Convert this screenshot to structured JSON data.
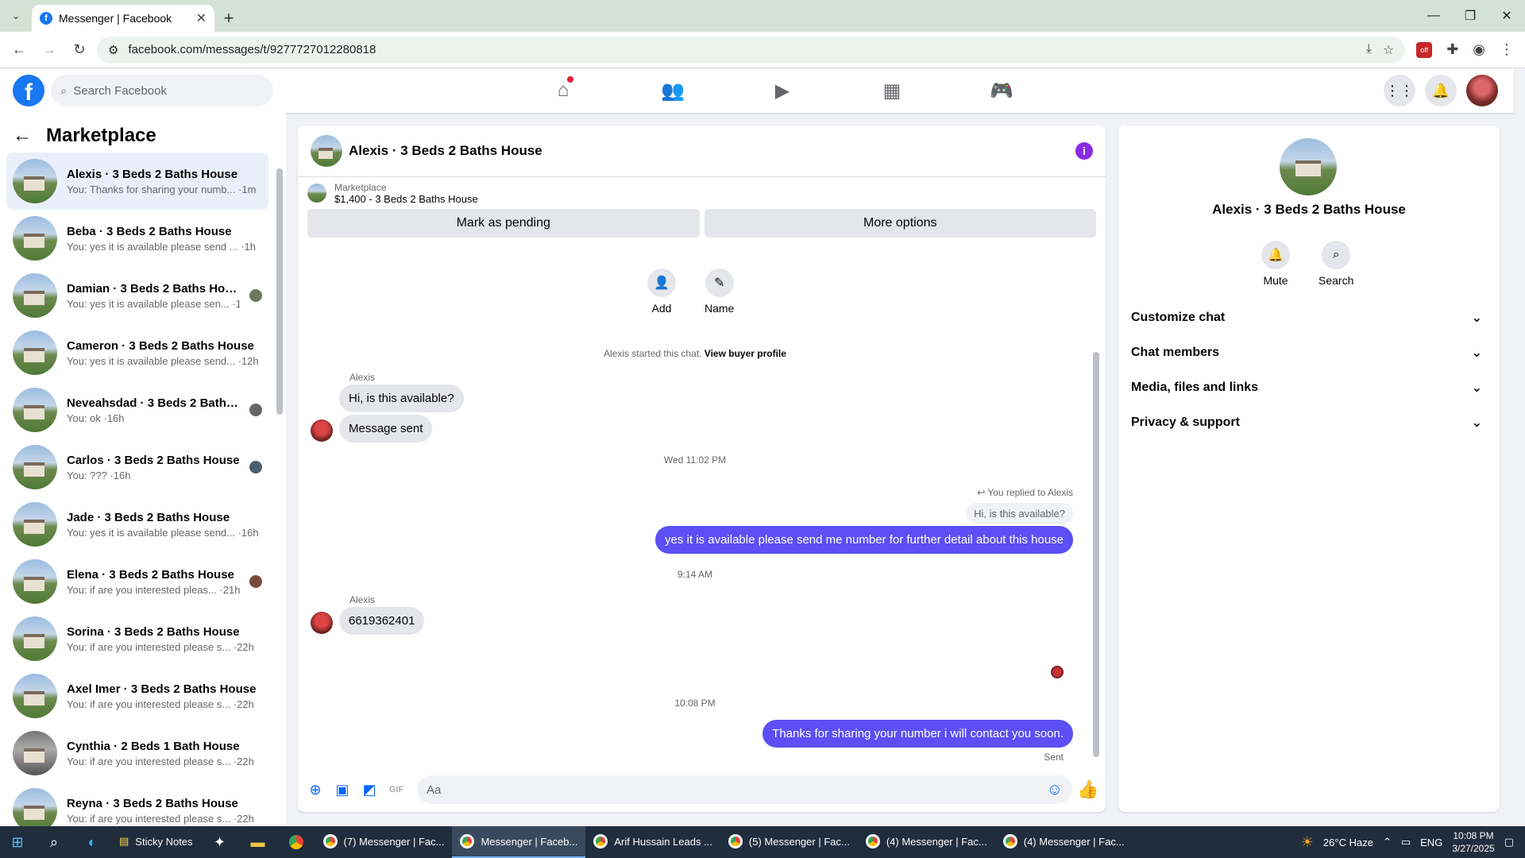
{
  "browser": {
    "tab_title": "Messenger | Facebook",
    "url": "facebook.com/messages/t/9277727012280818"
  },
  "header": {
    "search_placeholder": "Search Facebook",
    "logo": "f"
  },
  "left": {
    "title": "Marketplace",
    "conversations": [
      {
        "name": "Alexis · 3 Beds 2 Baths House",
        "preview": "You: Thanks for sharing your numb... ·1m"
      },
      {
        "name": "Beba · 3 Beds 2 Baths House",
        "preview": "You: yes it is available please send ... ·1h"
      },
      {
        "name": "Damian · 3 Beds 2 Baths House",
        "preview": "You: yes it is available please sen... ·1h"
      },
      {
        "name": "Cameron · 3 Beds 2 Baths House",
        "preview": "You: yes it is available please send... ·12h"
      },
      {
        "name": "Neveahsdad · 3 Beds 2 Baths ...",
        "preview": "You: ok ·16h"
      },
      {
        "name": "Carlos · 3 Beds 2 Baths House",
        "preview": "You: ??? ·16h"
      },
      {
        "name": "Jade · 3 Beds 2 Baths House",
        "preview": "You: yes it is available please send... ·16h"
      },
      {
        "name": "Elena · 3 Beds 2 Baths House",
        "preview": "You: if are you interested pleas... ·21h"
      },
      {
        "name": "Sorina · 3 Beds 2 Baths House",
        "preview": "You: if are you interested please s... ·22h"
      },
      {
        "name": "Axel Imer · 3 Beds 2 Baths House",
        "preview": "You: if are you interested please s... ·22h"
      },
      {
        "name": "Cynthia · 2 Beds 1 Bath House",
        "preview": "You: if are you interested please s... ·22h"
      },
      {
        "name": "Reyna · 3 Beds 2 Baths House",
        "preview": "You: if are you interested please s... ·22h"
      }
    ]
  },
  "chat": {
    "title": "Alexis · 3 Beds 2 Baths House",
    "listing_category": "Marketplace",
    "listing_price": "$1,400 - 3 Beds 2 Baths House",
    "btn_pending": "Mark as pending",
    "btn_more": "More options",
    "add_label": "Add",
    "name_label": "Name",
    "started_text": "Alexis started this chat.",
    "view_profile": "View buyer profile",
    "sender": "Alexis",
    "msg1": "Hi, is this available?",
    "msg2": "Message sent",
    "time1": "Wed 11:02 PM",
    "replied_label": "You replied to Alexis",
    "reply_quote": "Hi, is this available?",
    "msg3": "yes it is available please send me number for further detail about this house",
    "time2": "9:14 AM",
    "msg4": "6619362401",
    "time3": "10:08 PM",
    "msg5": "Thanks for sharing your number i will contact you soon.",
    "sent": "Sent",
    "composer_placeholder": "Aa"
  },
  "right": {
    "name": "Alexis · 3 Beds 2 Baths House",
    "mute": "Mute",
    "search": "Search",
    "sections": [
      "Customize chat",
      "Chat members",
      "Media, files and links",
      "Privacy & support"
    ]
  },
  "taskbar": {
    "apps": [
      "Sticky Notes",
      "(7) Messenger | Fac...",
      "Messenger | Faceb...",
      "Arif Hussain Leads ...",
      "(5) Messenger | Fac...",
      "(4) Messenger | Fac...",
      "(4) Messenger | Fac..."
    ],
    "weather": "26°C  Haze",
    "lang": "ENG",
    "time": "10:08 PM",
    "date": "3/27/2025"
  }
}
